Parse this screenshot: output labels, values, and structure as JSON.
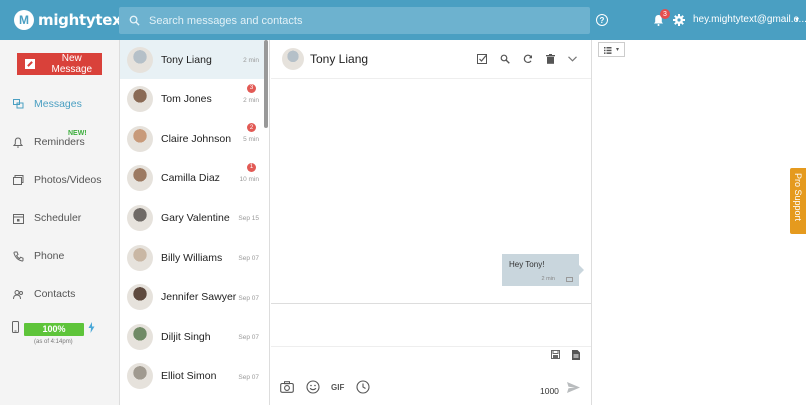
{
  "app": {
    "brand": "mightytext",
    "logo_mark": "M"
  },
  "header": {
    "search_placeholder": "Search messages and contacts",
    "notification_count": "3",
    "account": "hey.mightytext@gmail.c...",
    "help_label": "?"
  },
  "sidebar": {
    "new_message": "New Message",
    "items": [
      {
        "label": "Messages",
        "icon": "messages-icon",
        "active": true
      },
      {
        "label": "Reminders",
        "icon": "bell-icon"
      },
      {
        "label": "Photos/Videos",
        "icon": "photos-icon"
      },
      {
        "label": "Scheduler",
        "icon": "calendar-icon"
      },
      {
        "label": "Phone",
        "icon": "phone-icon"
      },
      {
        "label": "Contacts",
        "icon": "contacts-icon"
      }
    ],
    "new_tag": "NEW!",
    "battery": {
      "level": "100%",
      "note": "(as of 4:14pm)"
    }
  },
  "conversations": [
    {
      "name": "Tony Liang",
      "time": "2 min",
      "badge": "",
      "color": "#b5c0c8"
    },
    {
      "name": "Tom Jones",
      "time": "2 min",
      "badge": "3",
      "color": "#8a6a55"
    },
    {
      "name": "Claire Johnson",
      "time": "5 min",
      "badge": "2",
      "color": "#c89a7a"
    },
    {
      "name": "Camilla Diaz",
      "time": "10 min",
      "badge": "1",
      "color": "#9c7a62"
    },
    {
      "name": "Gary Valentine",
      "time": "Sep 15",
      "badge": "",
      "color": "#6f6a66"
    },
    {
      "name": "Billy Williams",
      "time": "Sep 07",
      "badge": "",
      "color": "#c9b7a4"
    },
    {
      "name": "Jennifer Sawyer",
      "time": "Sep 07",
      "badge": "",
      "color": "#5e4a3e"
    },
    {
      "name": "Diljit Singh",
      "time": "Sep 07",
      "badge": "",
      "color": "#708a66"
    },
    {
      "name": "Elliot Simon",
      "time": "Sep 07",
      "badge": "",
      "color": "#a09a90"
    }
  ],
  "chat": {
    "contact": "Tony Liang",
    "messages": [
      {
        "text": "Hey Tony!",
        "time": "2 min"
      }
    ],
    "gif_label": "GIF",
    "char_count": "1000"
  },
  "pro_support": "Pro Support",
  "colors": {
    "primary": "#4a9fc2",
    "accent_red": "#d9413a",
    "battery": "#5ec43a",
    "support": "#e59a1e"
  }
}
